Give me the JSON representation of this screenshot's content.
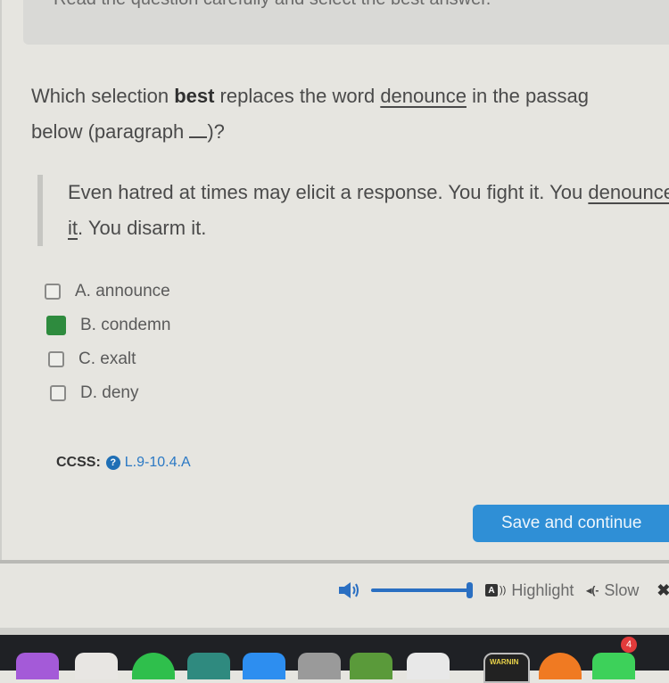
{
  "instructions": "Read the question carefully and select the best answer.",
  "question": {
    "prefix": "Which selection ",
    "emphasis": "best",
    "middle": " replaces the word ",
    "target_word": "denounce",
    "suffix": " in the passag",
    "line2_prefix": "below (paragraph ",
    "line2_suffix": ")?"
  },
  "passage": {
    "text1": "Even hatred at times may elicit a response. You fight it. You ",
    "underlined": "denounce it",
    "text2": ". You disarm it."
  },
  "options": [
    {
      "label": "A. announce",
      "selected": false
    },
    {
      "label": "B. condemn",
      "selected": true
    },
    {
      "label": "C. exalt",
      "selected": false
    },
    {
      "label": "D. deny",
      "selected": false
    }
  ],
  "ccss": {
    "label": "CCSS:",
    "help_icon": "?",
    "code": "L.9-10.4.A"
  },
  "save_button": "Save and continue",
  "audio_toolbar": {
    "volume_percent": 100,
    "highlight_icon": "A",
    "highlight_label": "Highlight",
    "slow_label": "Slow",
    "close_icon": "✖"
  },
  "dock": {
    "warning_app_text": "WARNIN",
    "messages_badge": "4"
  },
  "colors": {
    "accent": "#2f8fd6",
    "selected": "#2e8b3e",
    "link": "#2a78c4"
  }
}
